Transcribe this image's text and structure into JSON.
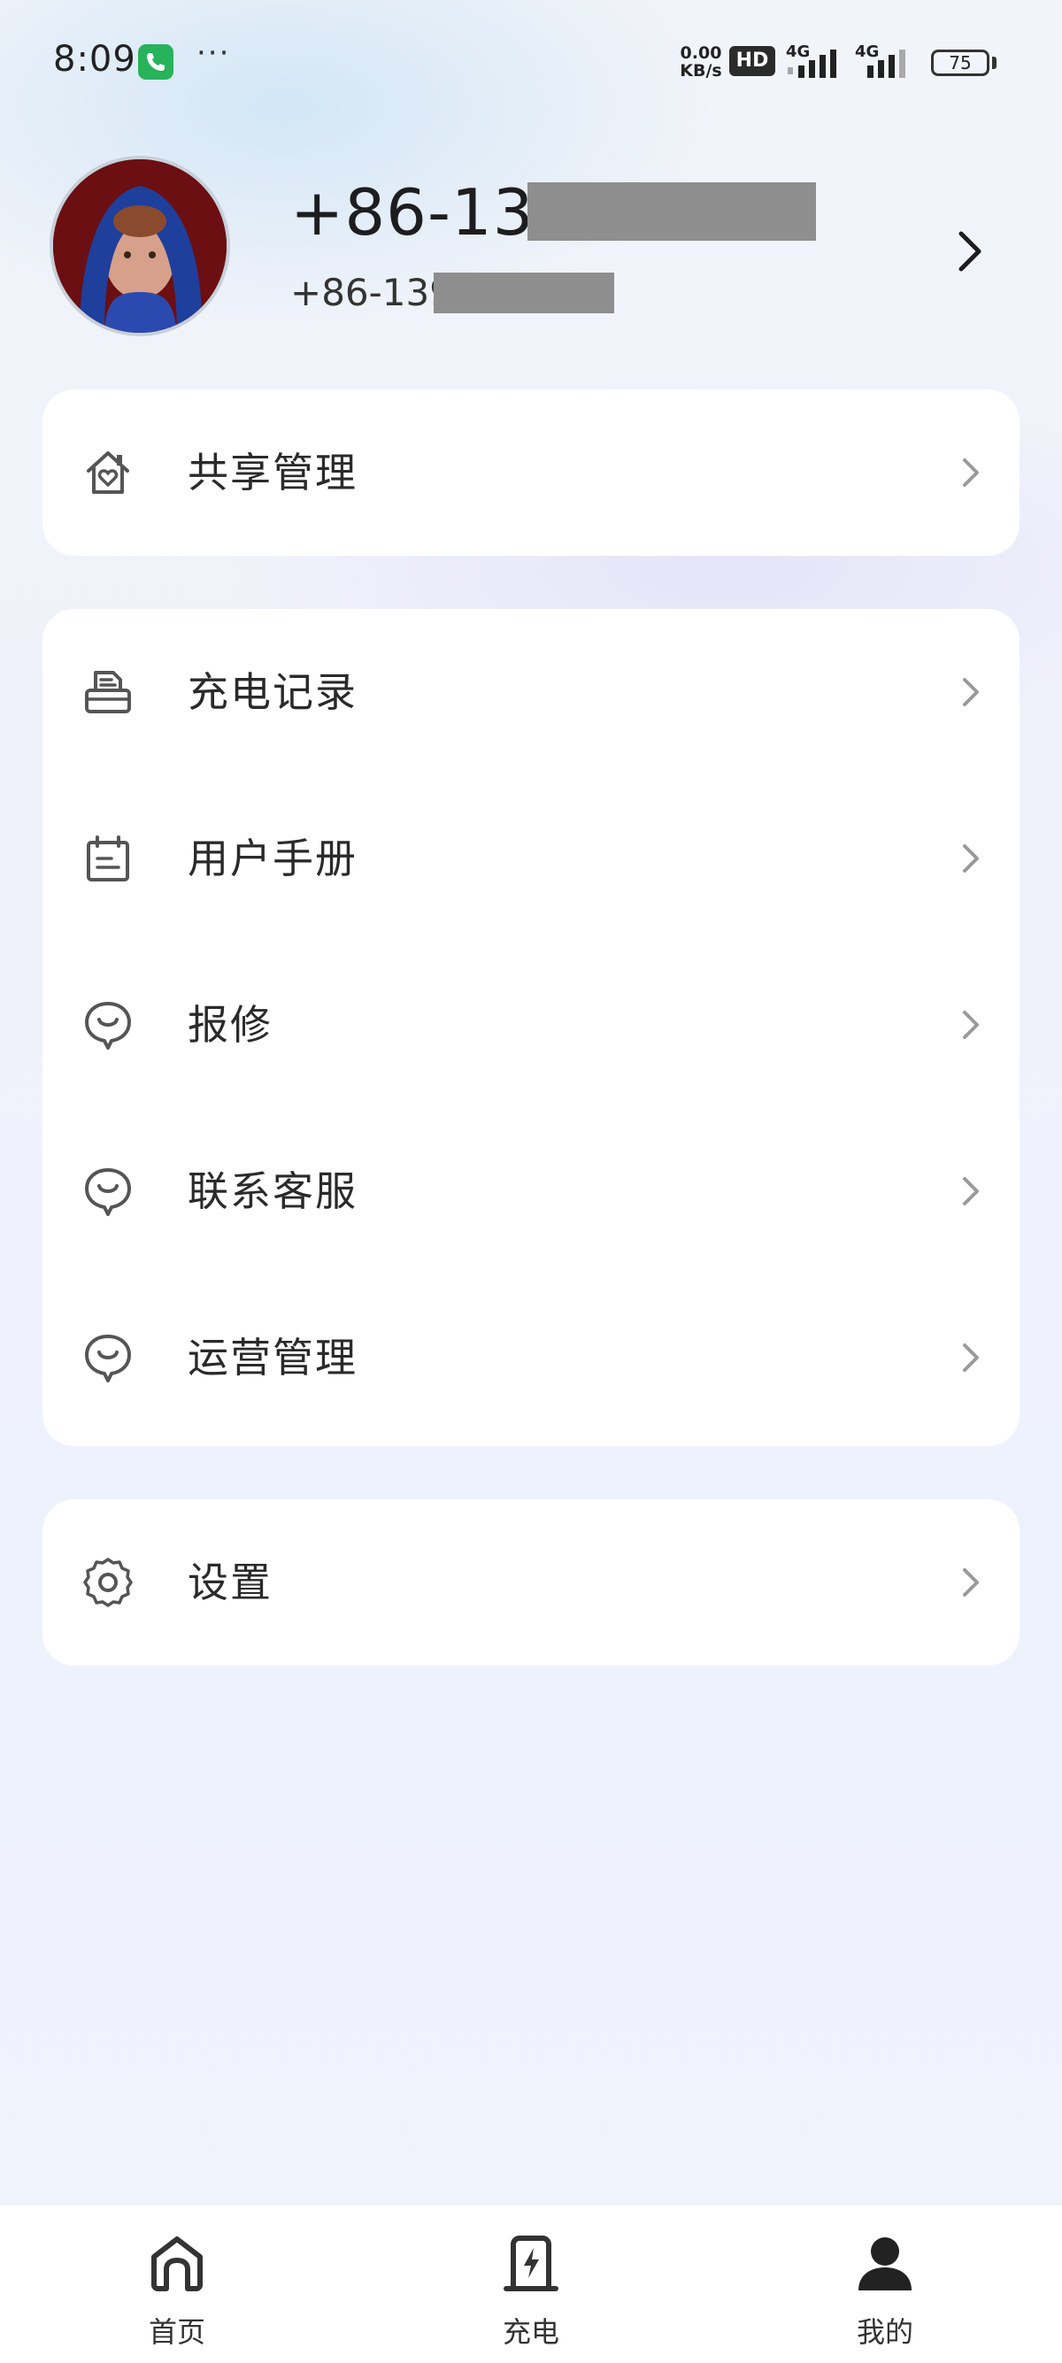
{
  "status_bar": {
    "time": "8:09",
    "more": "···",
    "net_speed_value": "0.00",
    "net_speed_unit": "KB/s",
    "hd_badge": "HD",
    "sim1": "4G",
    "sim2": "4G",
    "battery": "75"
  },
  "profile": {
    "phone_main": "+86-139",
    "phone_sub": "+86-139"
  },
  "menu": {
    "group1": [
      {
        "label": "共享管理",
        "icon": "house-heart-icon"
      }
    ],
    "group2": [
      {
        "label": "充电记录",
        "icon": "printer-record-icon"
      },
      {
        "label": "用户手册",
        "icon": "calendar-manual-icon"
      },
      {
        "label": "报修",
        "icon": "chat-smile-icon"
      },
      {
        "label": "联系客服",
        "icon": "chat-smile-icon"
      },
      {
        "label": "运营管理",
        "icon": "chat-smile-icon"
      }
    ],
    "group3": [
      {
        "label": "设置",
        "icon": "gear-icon"
      }
    ]
  },
  "bottom_nav": [
    {
      "label": "首页",
      "icon": "home-icon"
    },
    {
      "label": "充电",
      "icon": "charger-icon"
    },
    {
      "label": "我的",
      "icon": "user-icon",
      "active": true
    }
  ],
  "colors": {
    "accent_call": "#27b35a",
    "card_bg": "#ffffff",
    "text_primary": "#2a2a2a",
    "chevron": "#9a9a9a"
  }
}
